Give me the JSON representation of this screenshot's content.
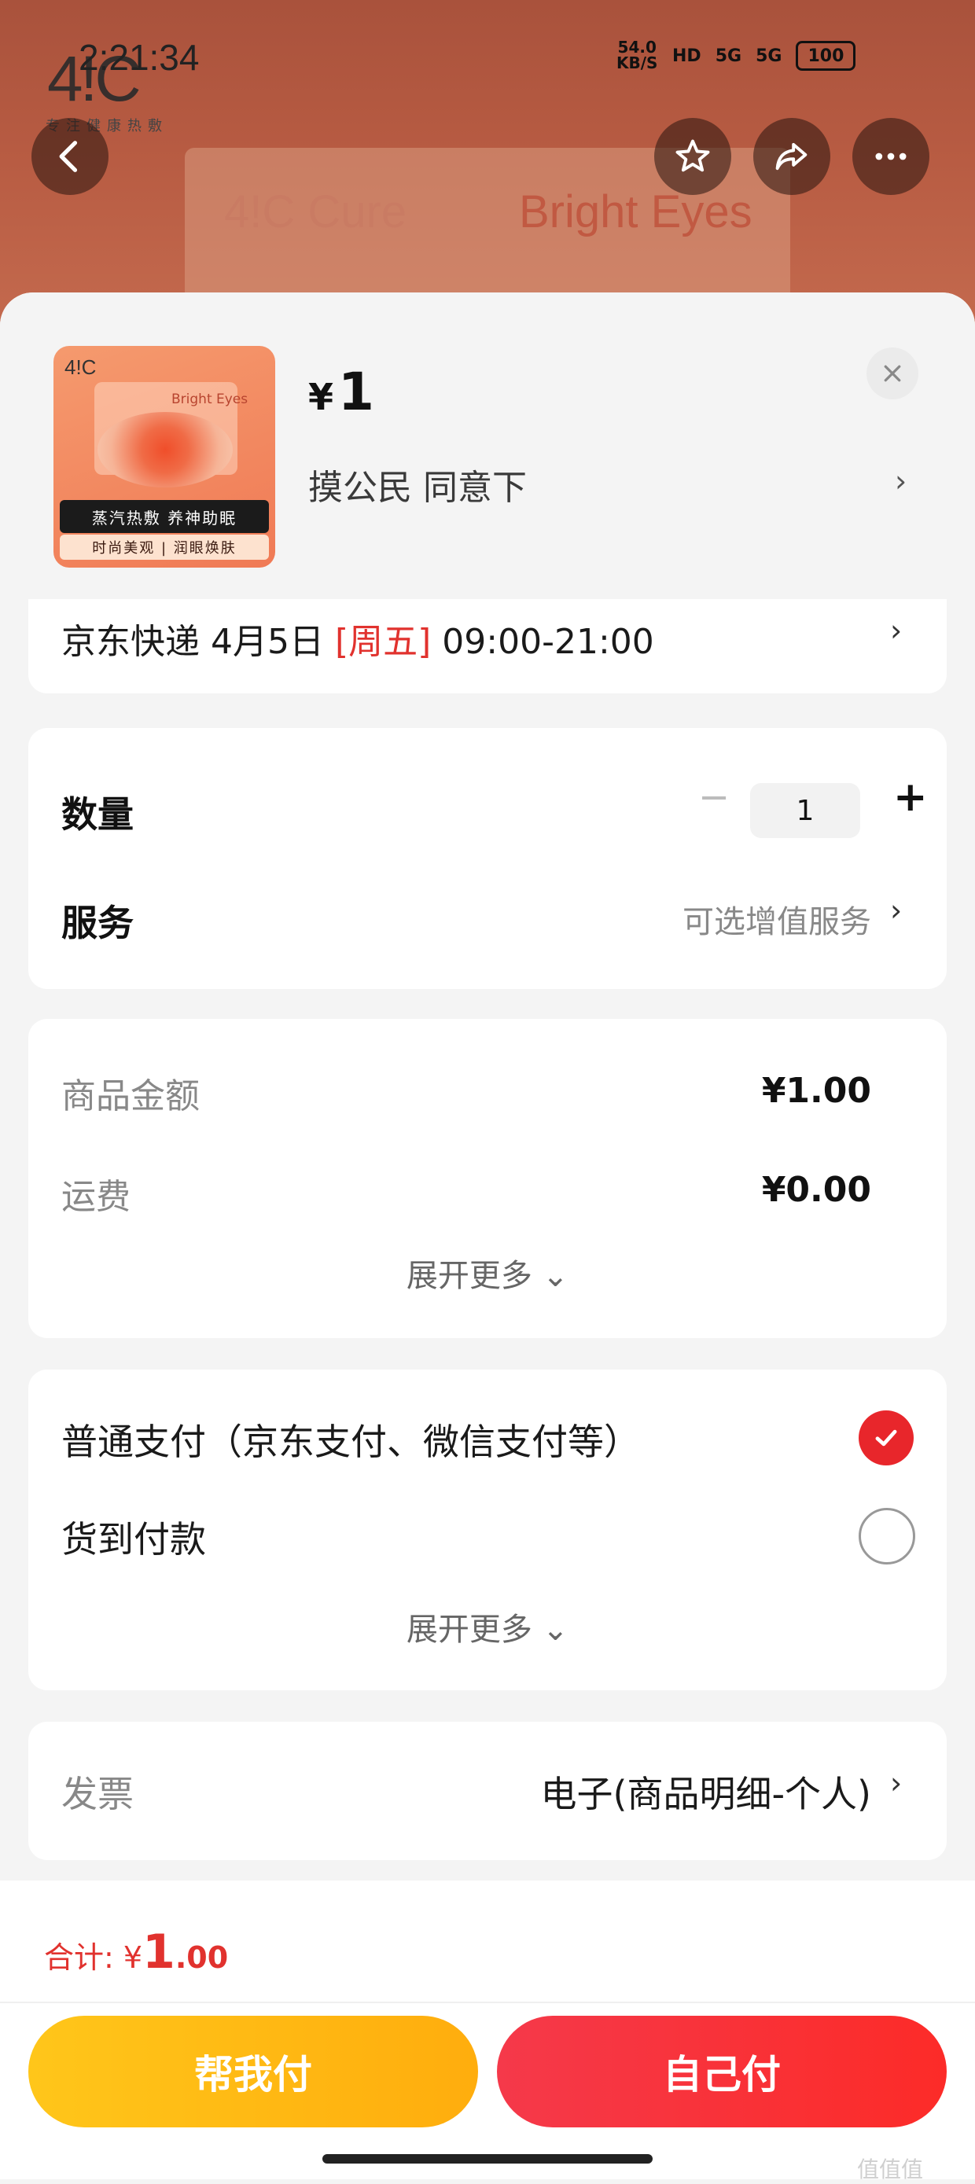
{
  "status_bar": {
    "time": "2:21:34",
    "net_speed": "54.0",
    "net_unit": "KB/S",
    "hd": "HD",
    "signal_1": "5G",
    "signal_2": "5G",
    "battery": "100"
  },
  "backdrop": {
    "logo": "4!C",
    "logo_sub": "专注健康热敷",
    "brand_left": "4!C Cure",
    "brand_right": "Bright Eyes"
  },
  "top_buttons": {
    "back_icon": "chevron-left-icon",
    "favorite_icon": "star-icon",
    "share_icon": "share-icon",
    "more_icon": "more-icon"
  },
  "product": {
    "thumb_logo": "4!C",
    "thumb_brand": "Bright Eyes",
    "thumb_band": "蒸汽热敷 养神助眠",
    "thumb_sub": "时尚美观 | 润眼焕肤",
    "price_symbol": "¥",
    "price": "1",
    "address": "摸公民 同意下",
    "chevron": "›"
  },
  "delivery": {
    "prefix": "京东快递 4月5日 ",
    "day": "[周五]",
    "time": " 09:00-21:00",
    "chevron": "›"
  },
  "quantity": {
    "label": "数量",
    "minus": "−",
    "value": "1",
    "plus": "+"
  },
  "service": {
    "label": "服务",
    "value": "可选增值服务",
    "chevron": "›"
  },
  "amounts": {
    "goods_label": "商品金额",
    "goods_value": "¥1.00",
    "shipping_label": "运费",
    "shipping_value": "¥0.00",
    "expand": "展开更多 ⌄"
  },
  "payment": {
    "option_1": "普通支付（京东支付、微信支付等）",
    "option_1_selected": true,
    "option_2": "货到付款",
    "option_2_selected": false,
    "expand": "展开更多 ⌄"
  },
  "invoice": {
    "label": "发票",
    "value": "电子(商品明细-个人)",
    "chevron": "›"
  },
  "footer": {
    "total_label": "合计: ¥",
    "total_int": "1",
    "total_dec": ".00",
    "help_pay": "帮我付",
    "self_pay": "自己付",
    "watermark": "值值值"
  },
  "colors": {
    "accent_red": "#e1322e",
    "help_yellow": "#ffb814",
    "self_red": "#f7323c"
  }
}
